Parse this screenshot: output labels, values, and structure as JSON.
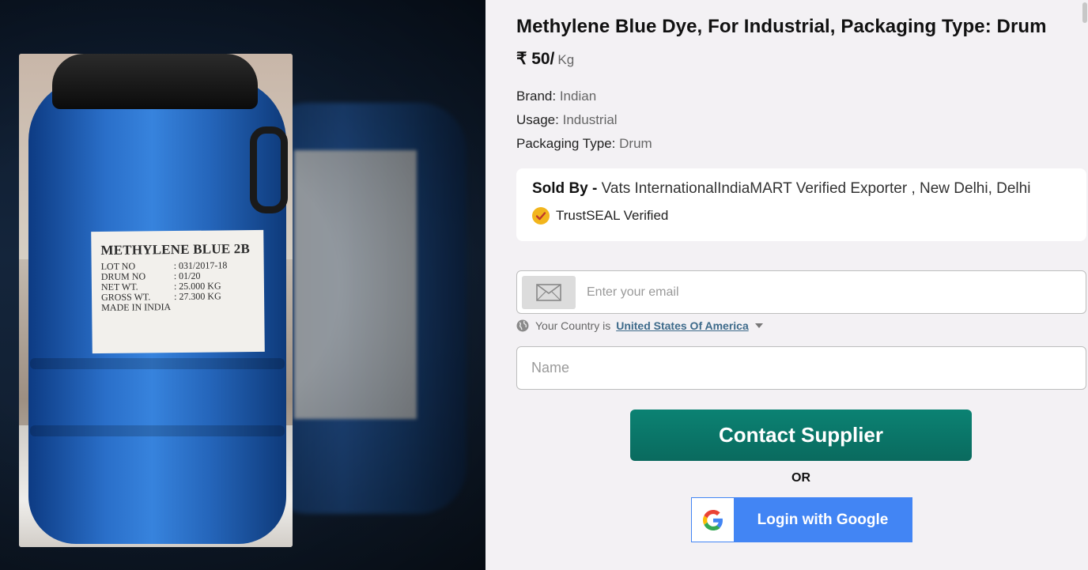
{
  "product": {
    "title": "Methylene Blue Dye, For Industrial, Packaging Type: Drum",
    "price_amount": "₹ 50/",
    "price_unit": "Kg",
    "specs": [
      {
        "label": "Brand:",
        "value": "Indian"
      },
      {
        "label": "Usage:",
        "value": "Industrial"
      },
      {
        "label": "Packaging Type:",
        "value": "Drum"
      }
    ]
  },
  "image": {
    "label_title": "METHYLENE BLUE 2B",
    "label_rows": [
      {
        "k": "LOT NO",
        "v": ":  031/2017-18"
      },
      {
        "k": "DRUM NO",
        "v": ":  01/20"
      },
      {
        "k": "NET WT.",
        "v": ":  25.000 KG"
      },
      {
        "k": "GROSS WT.",
        "v": ":  27.300 KG"
      },
      {
        "k": "MADE IN INDIA",
        "v": ""
      }
    ]
  },
  "seller": {
    "prefix": "Sold By -",
    "info": " Vats InternationalIndiaMART Verified Exporter , New Delhi, Delhi",
    "trust_text": "TrustSEAL Verified",
    "trust_color": "#f2b51c"
  },
  "form": {
    "email_placeholder": "Enter your email",
    "country_prefix": "Your Country is",
    "country_value": "United States Of America",
    "name_placeholder": "Name",
    "contact_label": "Contact Supplier",
    "or_label": "OR",
    "google_label": "Login with Google"
  },
  "colors": {
    "contact_button": "#0a7a6b",
    "google_button": "#4285f4"
  }
}
